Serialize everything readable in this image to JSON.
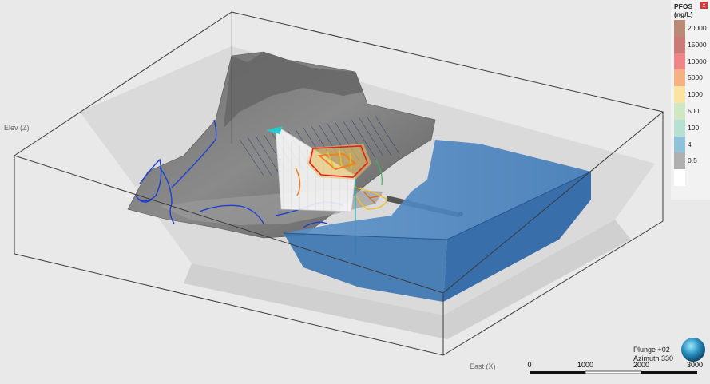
{
  "axes": {
    "elev_label": "Elev (Z)",
    "east_label": "East (X)"
  },
  "legend": {
    "title_line1": "PFOS",
    "title_line2": "(ng/L)",
    "close_glyph": "x",
    "entries": [
      {
        "label": "20000",
        "color": "#b98a75"
      },
      {
        "label": "15000",
        "color": "#c97b7b"
      },
      {
        "label": "10000",
        "color": "#ee8688"
      },
      {
        "label": "5000",
        "color": "#f4b183"
      },
      {
        "label": "1000",
        "color": "#fbe3a2"
      },
      {
        "label": "500",
        "color": "#cfe7c5"
      },
      {
        "label": "100",
        "color": "#b7dfd2"
      },
      {
        "label": "4",
        "color": "#8fc1d9"
      },
      {
        "label": "0.5",
        "color": "#b0b0b0"
      },
      {
        "label": "",
        "color": "#ffffff"
      }
    ]
  },
  "scale_bar": {
    "ticks": [
      "0",
      "1000",
      "2000",
      "3000"
    ]
  },
  "compass": {
    "plunge": "Plunge +02",
    "azimuth": "Azimuth 330",
    "icon": "globe-icon"
  },
  "colors": {
    "water": "#3d7fbd",
    "terrain": "#7e7e7e",
    "plume_red": "#e02020",
    "plume_yellow": "#f0c020",
    "contours": "#1f3fd0"
  }
}
